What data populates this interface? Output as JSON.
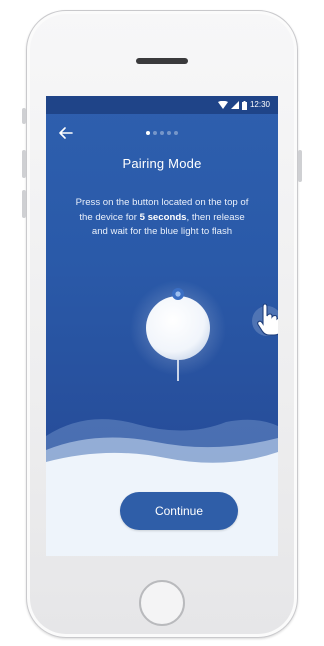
{
  "status_bar": {
    "time": "12:30",
    "icons": [
      "wifi-icon",
      "signal-icon",
      "battery-icon"
    ]
  },
  "header": {
    "back_icon": "arrow-left-icon",
    "pager": {
      "total": 5,
      "active_index": 0
    }
  },
  "main": {
    "title": "Pairing Mode",
    "instructions": {
      "before": "Press on the button located on the top of the device for ",
      "emphasis": "5 seconds",
      "after": ", then release and wait for the blue light to flash"
    },
    "illustration": [
      "device-icon",
      "hand-pointer-icon"
    ]
  },
  "footer": {
    "continue_label": "Continue"
  },
  "colors": {
    "screen_top": "#2e5fae",
    "screen_bottom": "#234792",
    "button": "#2f5ea8",
    "wave_light": "#eef4fb"
  }
}
